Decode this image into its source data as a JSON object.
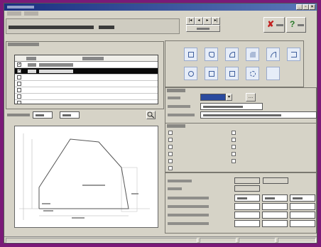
{
  "window": {
    "title": ""
  },
  "menubar": {
    "items": [
      {
        "label": ""
      },
      {
        "label": ""
      }
    ]
  },
  "header": {
    "title": "",
    "position_number": ""
  },
  "toolbar": {
    "prev_label": "",
    "next_label": "",
    "select_label": "",
    "close_label": "",
    "help_label": ""
  },
  "work_list": {
    "caption": "",
    "columns": [
      "",
      ""
    ],
    "rows": [
      {
        "checked": true,
        "number": "",
        "text": "",
        "selected": false
      },
      {
        "checked": true,
        "number": "",
        "text": "",
        "selected": true
      },
      {
        "checked": false,
        "number": "",
        "text": "",
        "selected": false
      },
      {
        "checked": false,
        "number": "",
        "text": "",
        "selected": false
      },
      {
        "checked": false,
        "number": "",
        "text": "",
        "selected": false
      },
      {
        "checked": false,
        "number": "",
        "text": "",
        "selected": false
      },
      {
        "checked": false,
        "number": "",
        "text": "",
        "selected": false
      }
    ]
  },
  "coords": {
    "label": "",
    "x_value": "",
    "y_value": ""
  },
  "tools": [
    "rectangle-tool-icon",
    "rounded-corner-tool-icon",
    "arc-tool-icon",
    "bevel-tool-icon",
    "curve-tool-icon",
    "bracket-tool-icon",
    "circle-tool-icon",
    "square-hole-tool-icon",
    "rect-slot-tool-icon",
    "gear-hole-tool-icon",
    "empty-tool-icon"
  ],
  "editor": {
    "caption": "",
    "fields": [
      {
        "label": "",
        "value": ""
      },
      {
        "label": "",
        "value": ""
      },
      {
        "label": "",
        "value": ""
      }
    ]
  },
  "parameters": {
    "caption": "",
    "checkboxes": [
      "",
      "",
      "",
      "",
      "",
      "",
      "",
      "",
      "",
      "",
      ""
    ]
  },
  "dims": [
    {
      "label": "",
      "values": [
        "",
        ""
      ]
    },
    {
      "label": "",
      "values": [
        ""
      ]
    }
  ],
  "bores": [
    {
      "label": "",
      "values": [
        "",
        "",
        ""
      ]
    },
    {
      "label": "",
      "values": [
        "",
        "",
        ""
      ]
    },
    {
      "label": "",
      "values": [
        "",
        "",
        ""
      ]
    },
    {
      "label": "",
      "values": [
        "",
        "",
        ""
      ]
    }
  ],
  "sketch": {
    "dimension_labels": [
      "",
      "",
      "",
      "",
      ""
    ]
  },
  "colors": {
    "desktop": "#7a1a78",
    "titlebar": "#1a2f80",
    "selection": "#0a0a0a",
    "tool_fill": "#e6edf8",
    "close_x": "#c22020",
    "help": "#2a7a2a"
  }
}
